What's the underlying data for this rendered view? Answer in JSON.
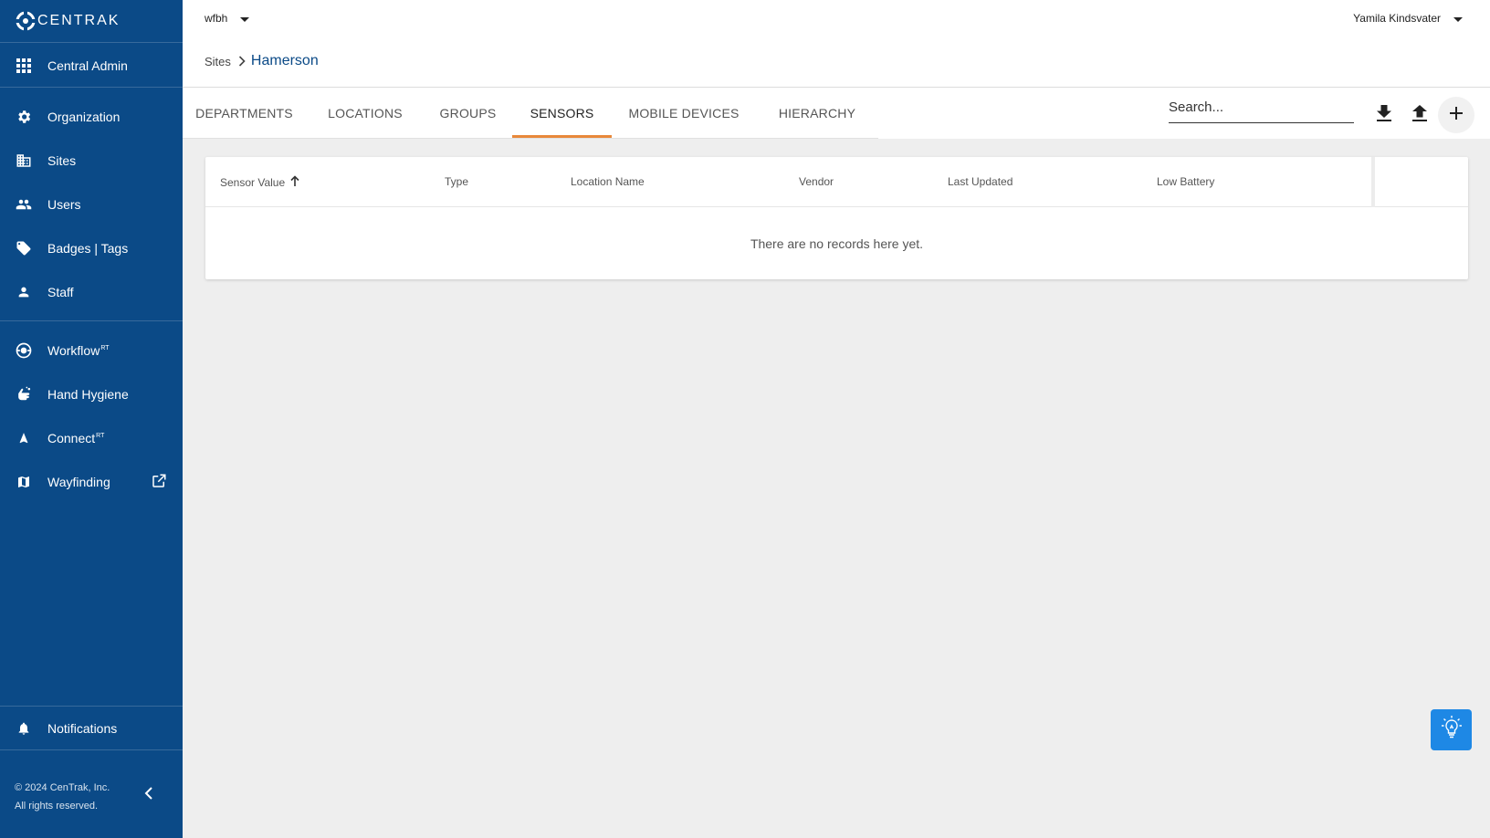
{
  "app": {
    "brand": "CENTRAK"
  },
  "sidebar": {
    "top_item": {
      "label": "Central Admin",
      "icon": "apps-grid-icon"
    },
    "items": [
      {
        "label": "Organization",
        "icon": "gear-icon"
      },
      {
        "label": "Sites",
        "icon": "building-icon"
      },
      {
        "label": "Users",
        "icon": "people-icon"
      },
      {
        "label": "Badges | Tags",
        "icon": "tag-icon"
      },
      {
        "label": "Staff",
        "icon": "person-icon"
      }
    ],
    "modules": [
      {
        "label": "Workflow",
        "sup": "RT",
        "icon": "workflow-icon"
      },
      {
        "label": "Hand Hygiene",
        "icon": "hand-wash-icon"
      },
      {
        "label": "Connect",
        "sup": "RT",
        "icon": "navigation-arrow-icon"
      },
      {
        "label": "Wayfinding",
        "icon": "map-icon",
        "external": true
      }
    ],
    "notifications": {
      "label": "Notifications",
      "icon": "bell-icon"
    },
    "copyright_line1": "© 2024 CenTrak, Inc.",
    "copyright_line2": "All rights reserved."
  },
  "topbar": {
    "tenant": "wfbh",
    "user": "Yamila Kindsvater",
    "breadcrumb": {
      "root": "Sites",
      "current": "Hamerson"
    }
  },
  "tabs": [
    {
      "label": "DEPARTMENTS",
      "active": false
    },
    {
      "label": "LOCATIONS",
      "active": false
    },
    {
      "label": "GROUPS",
      "active": false
    },
    {
      "label": "SENSORS",
      "active": true
    },
    {
      "label": "MOBILE DEVICES",
      "active": false
    },
    {
      "label": "HIERARCHY",
      "active": false
    }
  ],
  "search": {
    "placeholder": "Search..."
  },
  "table": {
    "columns": [
      "Sensor Value",
      "Type",
      "Location Name",
      "Vendor",
      "Last Updated",
      "Low Battery"
    ],
    "sorted_column": "Sensor Value",
    "sort_direction": "ascending",
    "empty_message": "There are no records here yet."
  },
  "colors": {
    "sidebar": "#0b4a87",
    "active_tab_underline": "#e8883a",
    "breadcrumb_current": "#0b4a87",
    "help_button": "#1e88e5"
  }
}
